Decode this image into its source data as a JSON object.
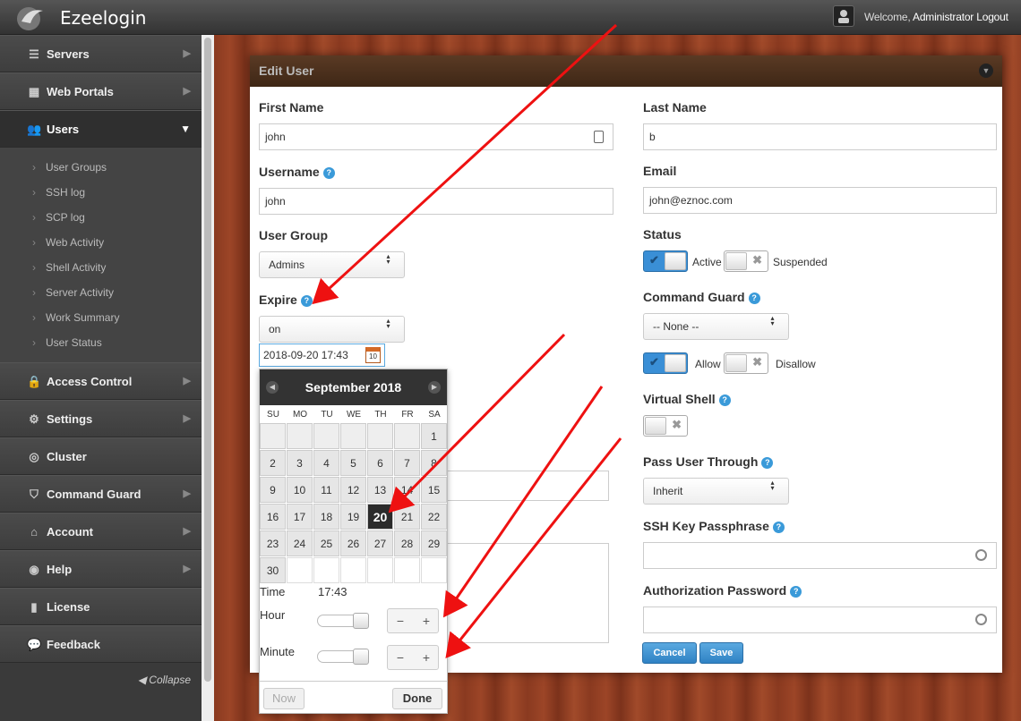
{
  "app": {
    "title": "Ezeelogin"
  },
  "header": {
    "welcome": "Welcome,",
    "user": "Administrator",
    "logout": "Logout"
  },
  "sidebar": {
    "items": [
      {
        "label": "Servers",
        "icon": "list-icon"
      },
      {
        "label": "Web Portals",
        "icon": "grid-icon"
      },
      {
        "label": "Users",
        "icon": "users-icon"
      },
      {
        "label": "Access Control",
        "icon": "lock-icon"
      },
      {
        "label": "Settings",
        "icon": "gear-icon"
      },
      {
        "label": "Cluster",
        "icon": "globe-icon"
      },
      {
        "label": "Command Guard",
        "icon": "shield-icon"
      },
      {
        "label": "Account",
        "icon": "home-icon"
      },
      {
        "label": "Help",
        "icon": "lifebuoy-icon"
      },
      {
        "label": "License",
        "icon": "document-icon"
      },
      {
        "label": "Feedback",
        "icon": "chat-icon"
      }
    ],
    "sub_items": [
      "User Groups",
      "SSH log",
      "SCP log",
      "Web Activity",
      "Shell Activity",
      "Server Activity",
      "Work Summary",
      "User Status"
    ],
    "collapse": "Collapse"
  },
  "panel": {
    "title": "Edit User"
  },
  "form": {
    "first_name": {
      "label": "First Name",
      "value": "john"
    },
    "last_name": {
      "label": "Last Name",
      "value": "b"
    },
    "username": {
      "label": "Username",
      "value": "john"
    },
    "email": {
      "label": "Email",
      "value": "john@eznoc.com"
    },
    "user_group": {
      "label": "User Group",
      "value": "Admins"
    },
    "status": {
      "label": "Status",
      "active": "Active",
      "suspended": "Suspended"
    },
    "expire": {
      "label": "Expire",
      "value": "on",
      "date": "2018-09-20 17:43"
    },
    "command_guard": {
      "label": "Command Guard",
      "value": "-- None --",
      "allow": "Allow",
      "disallow": "Disallow"
    },
    "virtual_shell": {
      "label": "Virtual Shell"
    },
    "pass_user_through": {
      "label": "Pass User Through",
      "value": "Inherit"
    },
    "ssh_key_passphrase": {
      "label": "SSH Key Passphrase",
      "value": ""
    },
    "authorization_password": {
      "label": "Authorization Password",
      "value": ""
    },
    "cancel": "Cancel",
    "save": "Save"
  },
  "datepicker": {
    "month": "September 2018",
    "dow": [
      "SU",
      "MO",
      "TU",
      "WE",
      "TH",
      "FR",
      "SA"
    ],
    "selected_day": "20",
    "time_label": "Time",
    "time_value": "17:43",
    "hour_label": "Hour",
    "minute_label": "Minute",
    "minus": "−",
    "plus": "+",
    "now": "Now",
    "done": "Done",
    "days": [
      "1",
      "2",
      "3",
      "4",
      "5",
      "6",
      "7",
      "8",
      "9",
      "10",
      "11",
      "12",
      "13",
      "14",
      "15",
      "16",
      "17",
      "18",
      "19",
      "20",
      "21",
      "22",
      "23",
      "24",
      "25",
      "26",
      "27",
      "28",
      "29",
      "30"
    ]
  },
  "colors": {
    "accent": "#3a8fd6",
    "annotation": "#ee1111",
    "header": "#3e2716"
  }
}
